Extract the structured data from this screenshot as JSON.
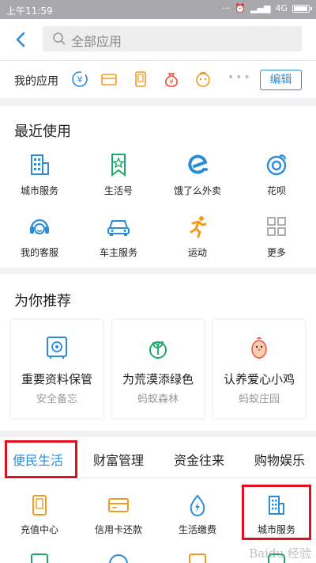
{
  "status_bar": {
    "time": "上午11:59",
    "network": "4G"
  },
  "search": {
    "placeholder": "全部应用"
  },
  "my_apps": {
    "label": "我的应用",
    "icons": [
      "yuan-exchange-icon",
      "card-icon",
      "phone-icon",
      "money-bag-icon",
      "smiley-icon"
    ],
    "more": "•••",
    "edit_label": "编辑"
  },
  "recent": {
    "title": "最近使用",
    "items": [
      {
        "label": "城市服务",
        "icon": "city-building-icon"
      },
      {
        "label": "生活号",
        "icon": "bookmark-star-icon"
      },
      {
        "label": "饿了么外卖",
        "icon": "eleme-icon"
      },
      {
        "label": "花呗",
        "icon": "huabei-icon"
      },
      {
        "label": "我的客服",
        "icon": "headset-icon"
      },
      {
        "label": "车主服务",
        "icon": "car-icon"
      },
      {
        "label": "运动",
        "icon": "running-icon"
      },
      {
        "label": "更多",
        "icon": "grid-icon"
      }
    ]
  },
  "recommend": {
    "title": "为你推荐",
    "cards": [
      {
        "title": "重要资料保管",
        "subtitle": "安全备忘",
        "icon": "safe-icon"
      },
      {
        "title": "为荒漠添绿色",
        "subtitle": "蚂蚁森林",
        "icon": "sprout-icon"
      },
      {
        "title": "认养爱心小鸡",
        "subtitle": "蚂蚁庄园",
        "icon": "chick-icon"
      }
    ]
  },
  "categories": {
    "tabs": [
      "便民生活",
      "财富管理",
      "资金往来",
      "购物娱乐"
    ],
    "active_tab": "便民生活",
    "items": [
      {
        "label": "充值中心",
        "icon": "phone-topup-icon"
      },
      {
        "label": "信用卡还款",
        "icon": "credit-card-icon"
      },
      {
        "label": "生活缴费",
        "icon": "water-drop-bolt-icon"
      },
      {
        "label": "城市服务",
        "icon": "city-building-icon"
      }
    ]
  },
  "watermark": "Baidu 经验",
  "colors": {
    "accent": "#2b8cd8",
    "orange": "#f39b1b",
    "green": "#1ea86b",
    "red_highlight": "#e0101e",
    "recent_icon_blue": "#2b8cd8"
  }
}
